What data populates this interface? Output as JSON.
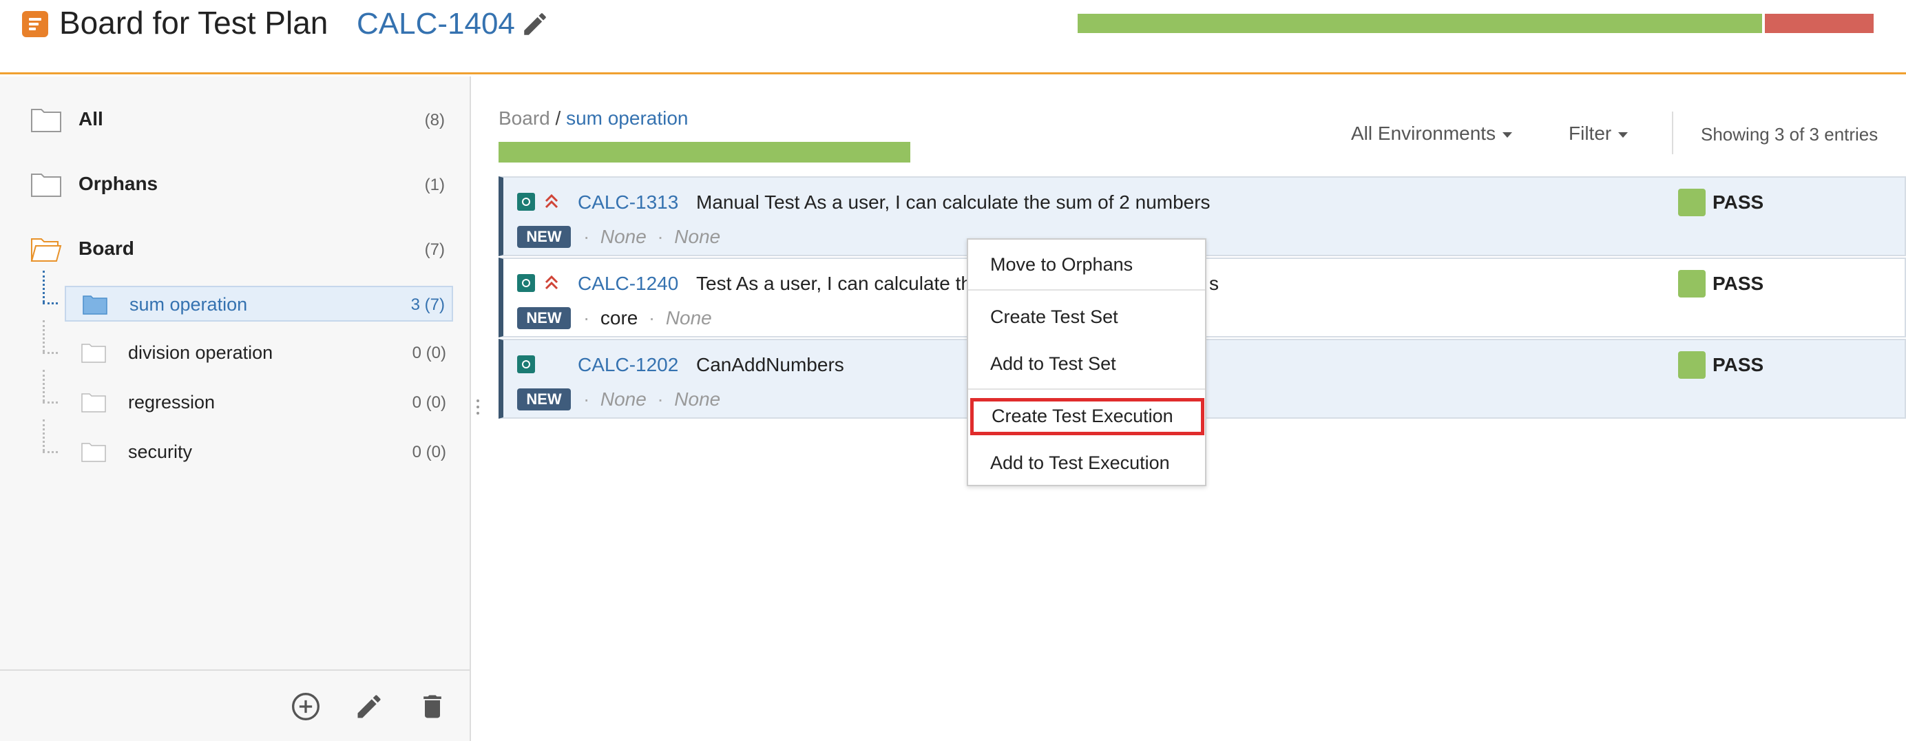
{
  "header": {
    "title": "Board for Test Plan",
    "plan_key": "CALC-1404",
    "progress": {
      "pass_fraction": 0.86,
      "fail_fraction": 0.14
    },
    "colors": {
      "accent": "#f0a030",
      "pass": "#94c260",
      "fail": "#d46259",
      "link": "#3572b0"
    }
  },
  "sidebar": {
    "roots": [
      {
        "label": "All",
        "count": "(8)",
        "icon": "folder-icon"
      },
      {
        "label": "Orphans",
        "count": "(1)",
        "icon": "folder-icon"
      },
      {
        "label": "Board",
        "count": "(7)",
        "icon": "folder-open-icon"
      }
    ],
    "children": [
      {
        "label": "sum operation",
        "count": "3 (7)",
        "selected": true
      },
      {
        "label": "division operation",
        "count": "0 (0)",
        "selected": false
      },
      {
        "label": "regression",
        "count": "0 (0)",
        "selected": false
      },
      {
        "label": "security",
        "count": "0 (0)",
        "selected": false
      }
    ],
    "footer_icons": [
      "add-circle-icon",
      "pencil-icon",
      "trash-icon"
    ]
  },
  "main": {
    "breadcrumb": {
      "root": "Board",
      "separator": "/",
      "current": "sum operation"
    },
    "folder_progress": {
      "pass_fraction": 1.0
    },
    "environments_label": "All Environments",
    "filter_label": "Filter",
    "entries_label": "Showing 3 of 3 entries",
    "tests": [
      {
        "key": "CALC-1313",
        "summary": "Manual Test As a user, I can calculate the sum of 2 numbers",
        "status": "NEW",
        "meta1": "None",
        "meta2": "None",
        "result": "PASS",
        "priority": "high"
      },
      {
        "key": "CALC-1240",
        "summary": "Test As a user, I can calculate th",
        "summary_tail": "s",
        "status": "NEW",
        "meta1": "core",
        "meta2": "None",
        "result": "PASS",
        "priority": "high"
      },
      {
        "key": "CALC-1202",
        "summary": "CanAddNumbers",
        "status": "NEW",
        "meta1": "None",
        "meta2": "None",
        "result": "PASS",
        "priority": "none"
      }
    ]
  },
  "context_menu": {
    "items": [
      {
        "label": "Move to Orphans"
      },
      {
        "label": "Create Test Set"
      },
      {
        "label": "Add to Test Set"
      },
      {
        "label": "Create Test Execution",
        "highlighted": true
      },
      {
        "label": "Add to Test Execution"
      }
    ]
  }
}
